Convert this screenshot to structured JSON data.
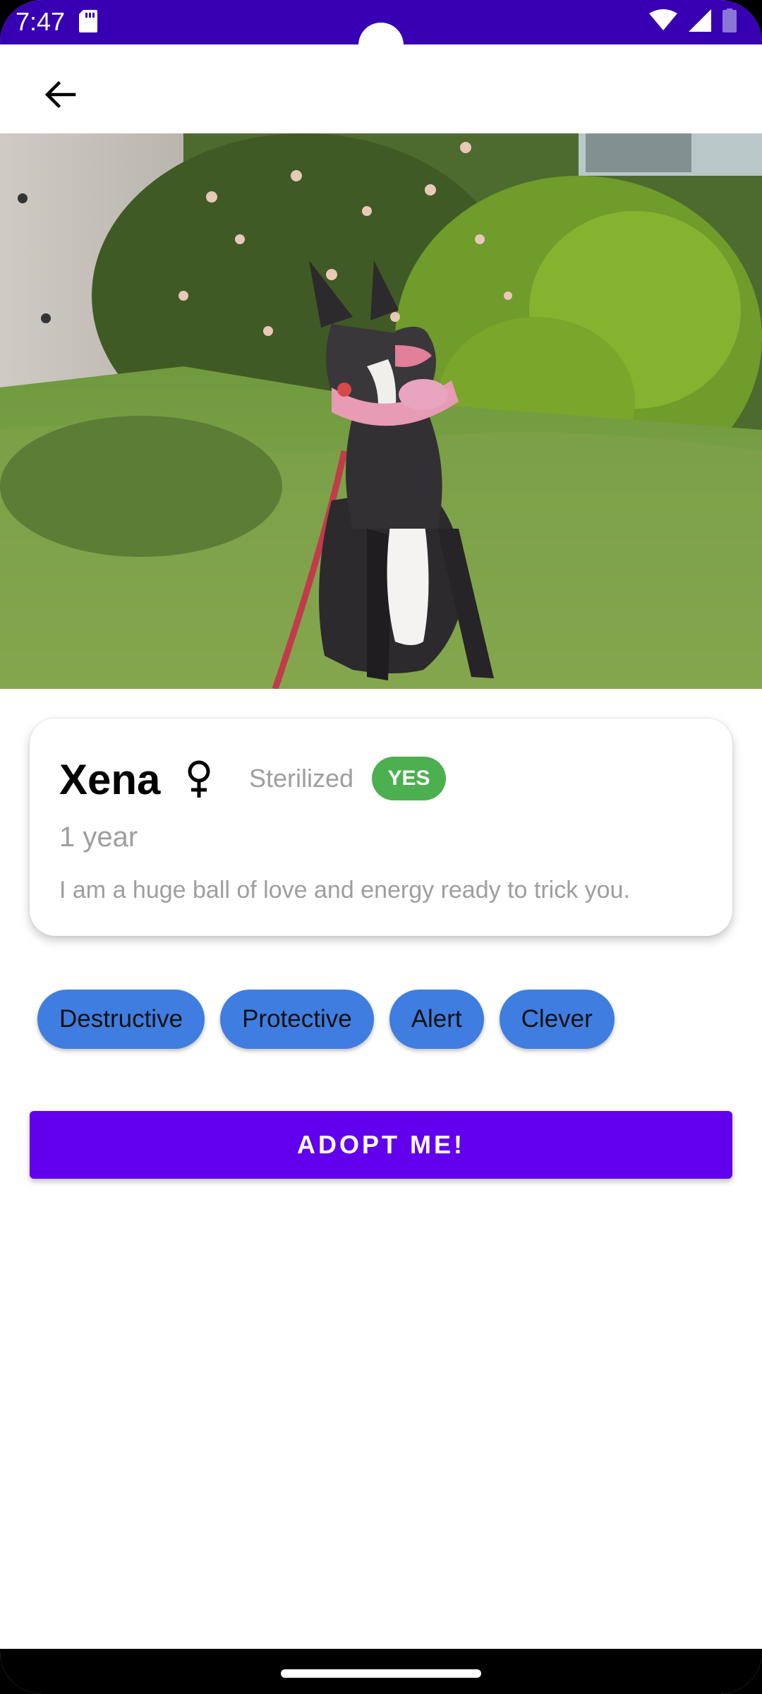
{
  "status_bar": {
    "time": "7:47",
    "background": "#3700b3",
    "icons": [
      "sd-card-icon",
      "wifi-icon",
      "signal-icon",
      "battery-icon"
    ]
  },
  "app_bar": {
    "back_icon": "arrow-back-icon"
  },
  "pet": {
    "name": "Xena",
    "gender_icon": "female-icon",
    "sterilized_label": "Sterilized",
    "sterilized_value": "YES",
    "age": "1 year",
    "description": "I am a huge ball of love and energy ready to trick you."
  },
  "traits": [
    "Destructive",
    "Protective",
    "Alert",
    "Clever"
  ],
  "actions": {
    "adopt_label": "ADOPT ME!"
  },
  "colors": {
    "primary": "#6200ee",
    "primary_dark": "#3700b3",
    "chip": "#3f7de0",
    "badge_yes": "#4caf50",
    "secondary_text": "#9e9e9e"
  }
}
